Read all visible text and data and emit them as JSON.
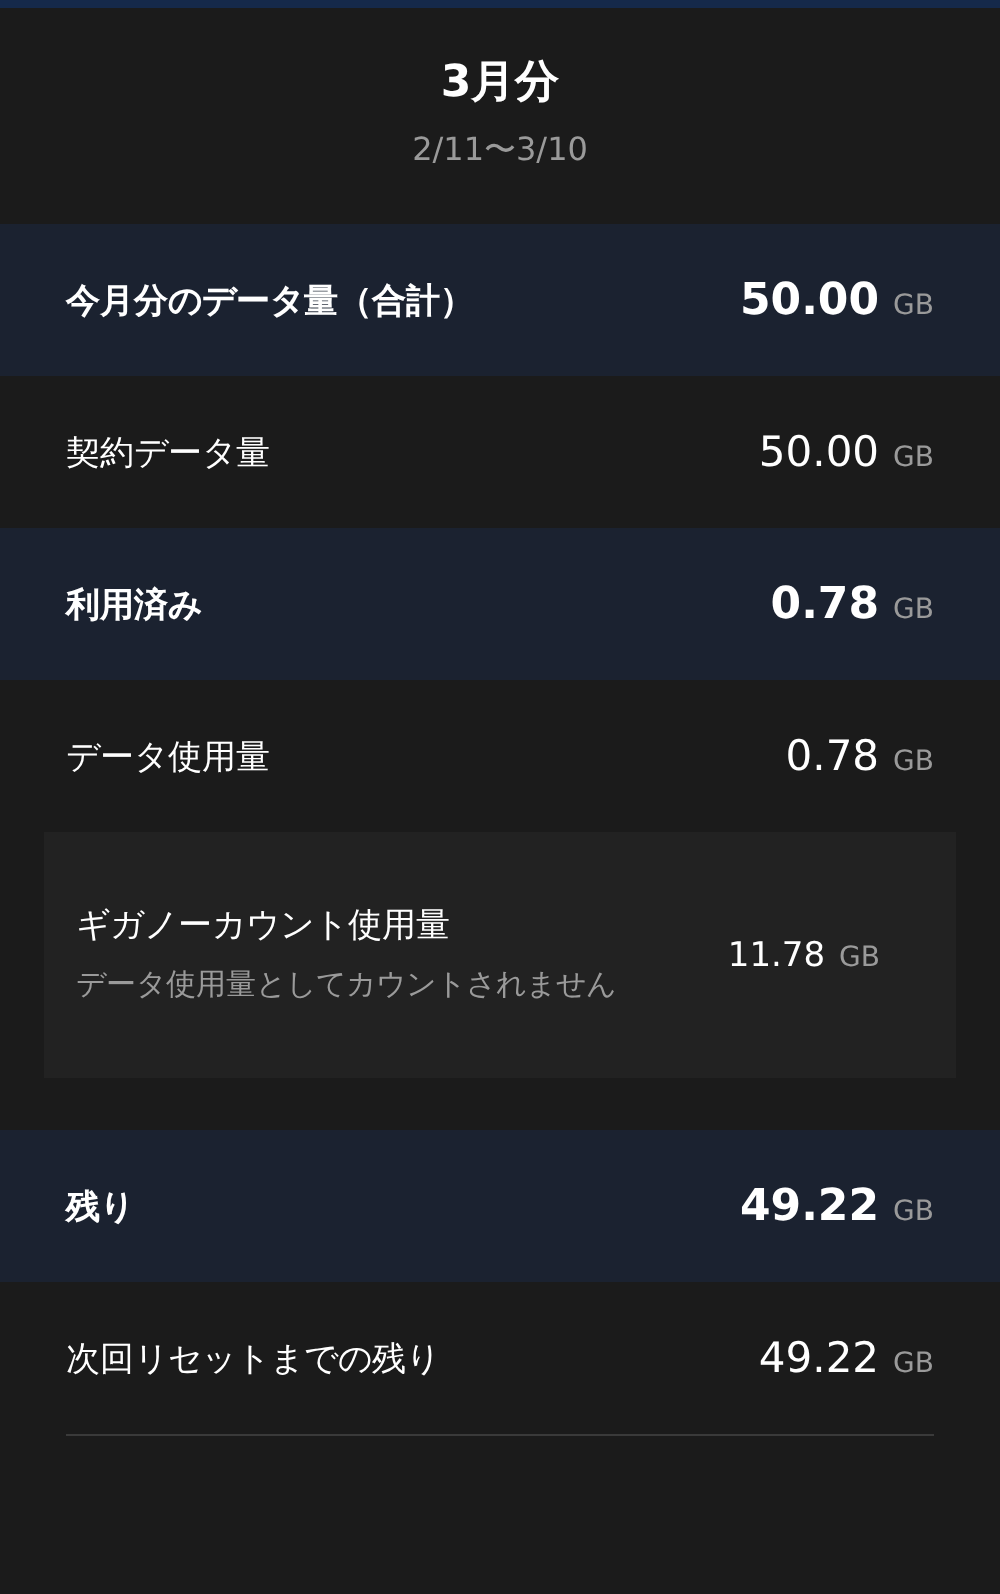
{
  "header": {
    "title": "3月分",
    "period": "2/11〜3/10"
  },
  "rows": [
    {
      "kind": "total",
      "label": "今月分のデータ量（合計）",
      "value": "50.00",
      "unit": "GB"
    },
    {
      "kind": "detail",
      "label": "契約データ量",
      "value": "50.00",
      "unit": "GB"
    },
    {
      "kind": "total",
      "label": "利用済み",
      "value": "0.78",
      "unit": "GB"
    },
    {
      "kind": "detail",
      "label": "データ使用量",
      "value": "0.78",
      "unit": "GB"
    },
    {
      "kind": "card",
      "label": "ギガノーカウント使用量",
      "note": "データ使用量としてカウントされません",
      "value": "11.78",
      "unit": "GB"
    },
    {
      "kind": "total",
      "label": "残り",
      "value": "49.22",
      "unit": "GB"
    },
    {
      "kind": "detail",
      "label": "次回リセットまでの残り",
      "value": "49.22",
      "unit": "GB"
    }
  ]
}
